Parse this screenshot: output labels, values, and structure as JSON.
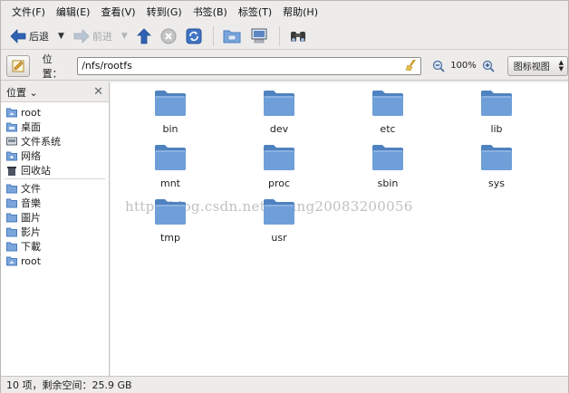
{
  "menubar": {
    "items": [
      "文件(F)",
      "编辑(E)",
      "查看(V)",
      "转到(G)",
      "书签(B)",
      "标签(T)",
      "帮助(H)"
    ]
  },
  "toolbar": {
    "back_label": "后退",
    "forward_label": "前进"
  },
  "location": {
    "label": "位置：",
    "path": "/nfs/rootfs",
    "zoom": "100%",
    "view_mode": "图标视图"
  },
  "sidebar": {
    "title": "位置",
    "groups": [
      [
        "root",
        "桌面",
        "文件系统",
        "网络",
        "回收站"
      ],
      [
        "文件",
        "音樂",
        "圖片",
        "影片",
        "下載",
        "root"
      ]
    ]
  },
  "files": [
    "bin",
    "dev",
    "etc",
    "lib",
    "mnt",
    "proc",
    "sbin",
    "sys",
    "tmp",
    "usr"
  ],
  "watermark": "http://blog.csdn.net/huang20083200056",
  "status": "10 项，剩余空间：25.9 GB",
  "colors": {
    "folder": "#6f9fd8",
    "folder_dark": "#4f82c0",
    "accent": "#3c6bb0"
  }
}
